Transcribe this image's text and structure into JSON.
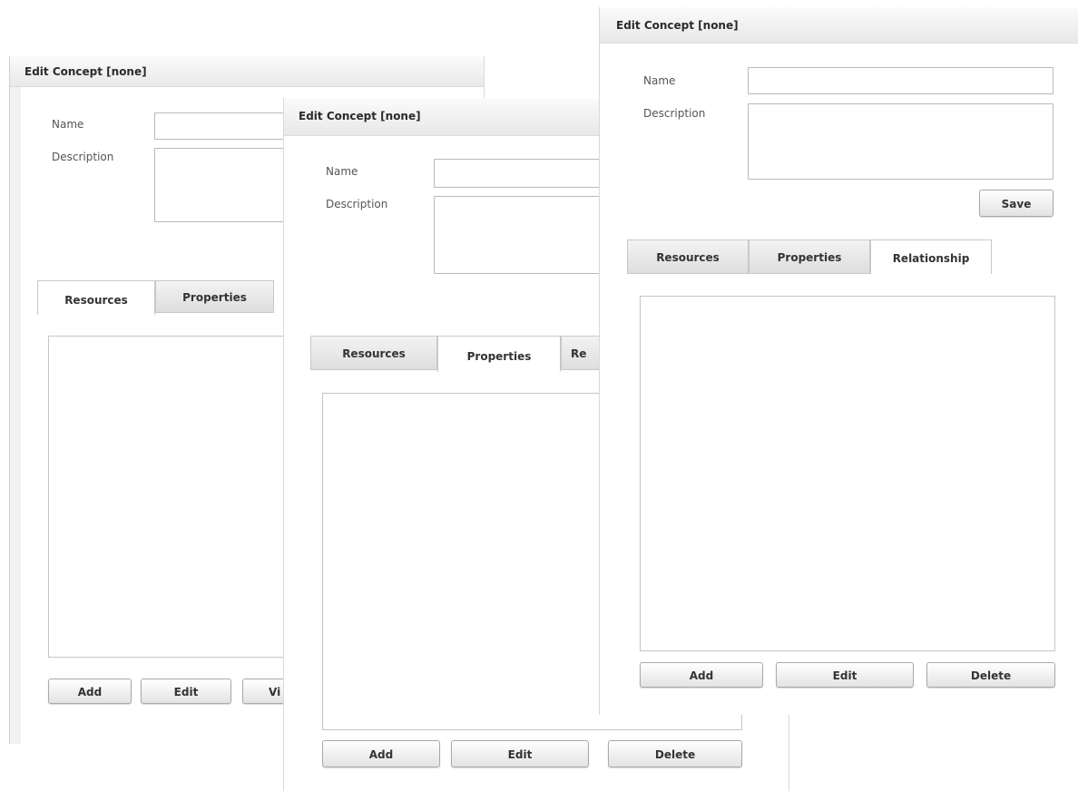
{
  "panels": [
    {
      "title": "Edit Concept [none]",
      "name_label": "Name",
      "description_label": "Description",
      "name_value": "",
      "description_value": "",
      "tabs": [
        "Resources",
        "Properties"
      ],
      "active_tab": "Resources",
      "buttons": [
        "Add",
        "Edit",
        "Vi"
      ]
    },
    {
      "title": "Edit Concept [none]",
      "name_label": "Name",
      "description_label": "Description",
      "name_value": "",
      "description_value": "",
      "tabs": [
        "Resources",
        "Properties",
        "Re"
      ],
      "active_tab": "Properties",
      "buttons": [
        "Add",
        "Edit",
        "Delete"
      ]
    },
    {
      "title": "Edit Concept [none]",
      "name_label": "Name",
      "description_label": "Description",
      "name_value": "",
      "description_value": "",
      "save_label": "Save",
      "tabs": [
        "Resources",
        "Properties",
        "Relationship"
      ],
      "active_tab": "Relationship",
      "buttons": [
        "Add",
        "Edit",
        "Delete"
      ]
    }
  ]
}
